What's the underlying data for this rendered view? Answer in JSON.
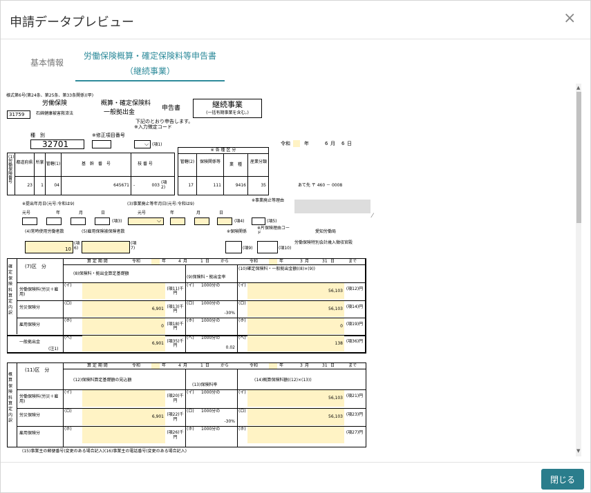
{
  "modal": {
    "title": "申請データプレビュー",
    "close_icon": "×",
    "close_button": "閉じる"
  },
  "tabs": [
    {
      "label": "基本情報"
    },
    {
      "label_line1": "労働保険概算・確定保険料等申告書",
      "label_line2": "（継続事業）"
    }
  ],
  "form": {
    "header": "様式第6号(第24条、第25条、第33条関係)(甲)",
    "code": "31759",
    "code_label": "石綿健康被害救済法",
    "insurance1": "労働保険",
    "insurance2": "概算・確定保険料",
    "insurance3": "一般拠出金",
    "shinkoku": "申告書",
    "jigyo": "継続事業",
    "jigyo_sub": "(一括有期事業を含む。)",
    "shita": "下記のとおり申告します。",
    "shubetsu_label": "種　別",
    "shubetsu": "32701",
    "correction_label": "※修正項目番号",
    "input_code_label": "※入力徴定コード",
    "c1": "(項1)",
    "date_era": "令和",
    "date_year": "年",
    "date_month": "6",
    "date_month_u": "月",
    "date_day": "6",
    "date_day_u": "日",
    "bango_label": "(1)労働保険番号",
    "cols": [
      "都道府県",
      "所掌",
      "管轄(1)",
      "基　幹　番　号",
      "枝 番 号"
    ],
    "vals": [
      "23",
      "1",
      "04",
      "645671",
      "-",
      "003"
    ],
    "c2": "(項2)",
    "kubun_title": "※ 各 種 区 分",
    "kubun_cols": [
      "管轄(2)",
      "保険関係等",
      "業　種",
      "産業分類"
    ],
    "kubun_vals": [
      "17",
      "111",
      "9416",
      "35"
    ],
    "atesaki": "あて先 〒 460 － 0008",
    "teishutsu": "※提出年月日(元号:令和は9)",
    "haishi": "(3)事業廃止等年月日(元号:令和は9)",
    "haishi_riyu": "※事業廃止等理由",
    "gengo": "元号",
    "nen": "年",
    "tsuki": "月",
    "hi": "日",
    "c3": "(項3)",
    "c4": "(項4)",
    "c5": "(項5)",
    "joji": "(4)常時使用労働者数",
    "koyo": "(5)雇用保険被保険者数",
    "hoken_kankei": "※保険関係",
    "katahoken": "※片保険理由コード",
    "c6": "(項6)",
    "c7": "(項7)",
    "c9": "(項9)",
    "c10": "(項10)",
    "joji_val": "10",
    "koyo_val": "",
    "kyoku": "愛知労働局",
    "tokubetsu": "労働保険特別会計歳入徴収官殿",
    "kakutei_label": "確定保険料算定内訳",
    "kubun7": "(7)区　分",
    "period": "算 定 期 間",
    "reiwa": "令和",
    "gatsu4": "4",
    "gatsu_u": "月",
    "tsuitachi": "1",
    "ka": "日",
    "kara": "から",
    "gatsu3": "3",
    "gatsu31": "31",
    "made": "まで",
    "h8": "(8)保険料・拠出金算定基礎額",
    "h9": "(9)保険料・拠出金率",
    "h10": "(10)確定保険料・一般拠出金額((8)×(9))",
    "rows": [
      {
        "name": "労働保険料(労災＋雇用)",
        "base": "",
        "unit1": "(項11)千円",
        "rate": "1000分の",
        "amount": "56,103",
        "unit2": "(項12)円"
      },
      {
        "name": "労災保険分",
        "base": "6,901",
        "unit1": "(項13)千円",
        "rate": "1000分の",
        "rate2": "-30%",
        "amount": "56,103",
        "unit2": "(項14)円"
      },
      {
        "name": "雇用保険分",
        "base": "0",
        "unit1": "(項18)千円",
        "rate": "1000分の",
        "amount": "0",
        "unit2": "(項19)円"
      },
      {
        "name": "一般拠出金",
        "name2": "(注1)",
        "base": "6,901",
        "unit1": "(項35)千円",
        "rate": "1000分の",
        "rate2": "0.02",
        "amount": "138",
        "unit2": "(項36)円"
      }
    ],
    "i": "(イ)",
    "ro": "(ロ)",
    "ho": "(ホ)",
    "he": "(ヘ)",
    "gaisan_label": "概算保険料算定内訳",
    "kubun11": "(11)区　分",
    "h12": "(12)保険料算定基礎額の見込額",
    "h13": "(13)保険料率",
    "h14": "(14)概算保険料額((12)×(13))",
    "rows2": [
      {
        "name": "労働保険料(労災＋雇用)",
        "base": "",
        "unit1": "(項20)千円",
        "rate": "1000分の",
        "amount": "56,103",
        "unit2": "(項21)円"
      },
      {
        "name": "労災保険分",
        "base": "6,901",
        "unit1": "(項22)千円",
        "rate": "1000分の",
        "rate2": "-30%",
        "amount": "56,103",
        "unit2": "(項23)円"
      },
      {
        "name": "雇用保険分",
        "base": "",
        "unit1": "(項26)千円",
        "rate": "1000分の",
        "amount": "",
        "unit2": "(項27)円"
      }
    ],
    "bottom": "(15)事業主の郵便番号(変更のある場合記入)(16)事業主の電話番号(変更のある場合記入)"
  }
}
